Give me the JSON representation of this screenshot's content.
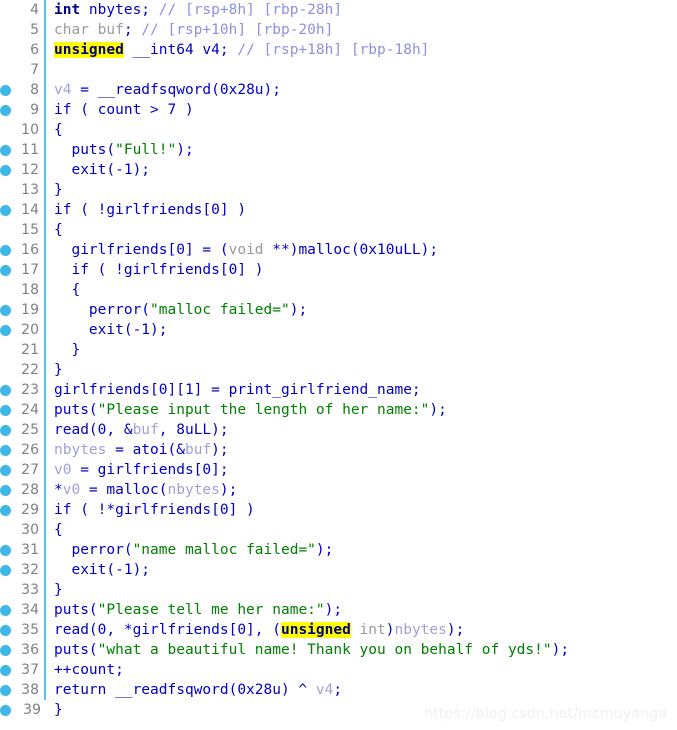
{
  "editor": {
    "kind": "decompiler-pseudocode",
    "language": "C",
    "accent_color": "#5bc0eb",
    "breakpoint_color": "#3eb8e8",
    "highlight_color": "#ffff00",
    "highlighted_token": "unsigned",
    "first_line_number": 4,
    "last_line_number": 39
  },
  "watermark": {
    "text": "https://blog.csdn.net/mcmuyanga"
  },
  "lines": [
    {
      "n": "4",
      "bp": false,
      "text": "int nbytes; // [rsp+8h] [rbp-28h]"
    },
    {
      "n": "5",
      "bp": false,
      "text": "char buf; // [rsp+10h] [rbp-20h]"
    },
    {
      "n": "6",
      "bp": false,
      "text": "unsigned __int64 v4; // [rsp+18h] [rbp-18h]"
    },
    {
      "n": "7",
      "bp": false,
      "text": ""
    },
    {
      "n": "8",
      "bp": true,
      "text": "v4 = __readfsqword(0x28u);"
    },
    {
      "n": "9",
      "bp": true,
      "text": "if ( count > 7 )"
    },
    {
      "n": "10",
      "bp": false,
      "text": "{"
    },
    {
      "n": "11",
      "bp": true,
      "text": "  puts(\"Full!\");"
    },
    {
      "n": "12",
      "bp": true,
      "text": "  exit(-1);"
    },
    {
      "n": "13",
      "bp": false,
      "text": "}"
    },
    {
      "n": "14",
      "bp": true,
      "text": "if ( !girlfriends[0] )"
    },
    {
      "n": "15",
      "bp": false,
      "text": "{"
    },
    {
      "n": "16",
      "bp": true,
      "text": "  girlfriends[0] = (void **)malloc(0x10uLL);"
    },
    {
      "n": "17",
      "bp": true,
      "text": "  if ( !girlfriends[0] )"
    },
    {
      "n": "18",
      "bp": false,
      "text": "  {"
    },
    {
      "n": "19",
      "bp": true,
      "text": "    perror(\"malloc failed=\");"
    },
    {
      "n": "20",
      "bp": true,
      "text": "    exit(-1);"
    },
    {
      "n": "21",
      "bp": false,
      "text": "  }"
    },
    {
      "n": "22",
      "bp": false,
      "text": "}"
    },
    {
      "n": "23",
      "bp": true,
      "text": "girlfriends[0][1] = print_girlfriend_name;"
    },
    {
      "n": "24",
      "bp": true,
      "text": "puts(\"Please input the length of her name:\");"
    },
    {
      "n": "25",
      "bp": true,
      "text": "read(0, &buf, 8uLL);"
    },
    {
      "n": "26",
      "bp": true,
      "text": "nbytes = atoi(&buf);"
    },
    {
      "n": "27",
      "bp": true,
      "text": "v0 = girlfriends[0];"
    },
    {
      "n": "28",
      "bp": true,
      "text": "*v0 = malloc(nbytes);"
    },
    {
      "n": "29",
      "bp": true,
      "text": "if ( !*girlfriends[0] )"
    },
    {
      "n": "30",
      "bp": false,
      "text": "{"
    },
    {
      "n": "31",
      "bp": true,
      "text": "  perror(\"name malloc failed=\");"
    },
    {
      "n": "32",
      "bp": true,
      "text": "  exit(-1);"
    },
    {
      "n": "33",
      "bp": false,
      "text": "}"
    },
    {
      "n": "34",
      "bp": true,
      "text": "puts(\"Please tell me her name:\");"
    },
    {
      "n": "35",
      "bp": true,
      "text": "read(0, *girlfriends[0], (unsigned int)nbytes);"
    },
    {
      "n": "36",
      "bp": true,
      "text": "puts(\"what a beautiful name! Thank you on behalf of yds!\");"
    },
    {
      "n": "37",
      "bp": true,
      "text": "++count;"
    },
    {
      "n": "38",
      "bp": true,
      "text": "return __readfsqword(0x28u) ^ v4;"
    },
    {
      "n": "39",
      "bp": true,
      "text": "}"
    }
  ],
  "tokens": {
    "line_4": [
      {
        "t": "int",
        "c": "kw"
      },
      {
        "t": " nbytes; ",
        "c": "plain"
      },
      {
        "t": "// [rsp+8h] [rbp-28h]",
        "c": "cmt"
      }
    ],
    "line_5": [
      {
        "t": "char",
        "c": "gray"
      },
      {
        "t": " buf",
        "c": "gray"
      },
      {
        "t": "; ",
        "c": "plain"
      },
      {
        "t": "// [rsp+10h] [rbp-20h]",
        "c": "cmt"
      }
    ],
    "line_6": [
      {
        "t": "unsigned",
        "c": "hl"
      },
      {
        "t": " __int64 v4; ",
        "c": "plain"
      },
      {
        "t": "// [rsp+18h] [rbp-18h]",
        "c": "cmt"
      }
    ],
    "line_8": [
      {
        "t": "v4",
        "c": "var"
      },
      {
        "t": " = __readfsqword(0x28u);",
        "c": "plain"
      }
    ],
    "line_16": [
      {
        "t": "  girlfriends[0] = (",
        "c": "plain"
      },
      {
        "t": "void",
        "c": "gray"
      },
      {
        "t": " **)malloc(0x10uLL);",
        "c": "plain"
      }
    ],
    "line_19": [
      {
        "t": "    perror(",
        "c": "plain"
      },
      {
        "t": "\"malloc failed=\"",
        "c": "str"
      },
      {
        "t": ");",
        "c": "plain"
      }
    ],
    "line_25": [
      {
        "t": "read(0, &",
        "c": "plain"
      },
      {
        "t": "buf",
        "c": "var"
      },
      {
        "t": ", 8uLL);",
        "c": "plain"
      }
    ],
    "line_26": [
      {
        "t": "nbytes",
        "c": "var"
      },
      {
        "t": " = atoi(&",
        "c": "plain"
      },
      {
        "t": "buf",
        "c": "var"
      },
      {
        "t": ");",
        "c": "plain"
      }
    ],
    "line_27": [
      {
        "t": "v0",
        "c": "var"
      },
      {
        "t": " = girlfriends[0];",
        "c": "plain"
      }
    ],
    "line_28": [
      {
        "t": "*",
        "c": "plain"
      },
      {
        "t": "v0",
        "c": "var"
      },
      {
        "t": " = malloc(",
        "c": "plain"
      },
      {
        "t": "nbytes",
        "c": "var"
      },
      {
        "t": ");",
        "c": "plain"
      }
    ],
    "line_35": [
      {
        "t": "read(0, *girlfriends[0], (",
        "c": "plain"
      },
      {
        "t": "unsigned",
        "c": "hl"
      },
      {
        "t": " int",
        "c": "gray"
      },
      {
        "t": ")",
        "c": "plain"
      },
      {
        "t": "nbytes",
        "c": "var"
      },
      {
        "t": ");",
        "c": "plain"
      }
    ],
    "line_38": [
      {
        "t": "return __readfsqword(0x28u) ^ ",
        "c": "plain"
      },
      {
        "t": "v4",
        "c": "var"
      },
      {
        "t": ";",
        "c": "plain"
      }
    ]
  },
  "rendered": [
    {
      "n": "4",
      "bp": false,
      "parts": [
        {
          "t": "int",
          "c": "kw"
        },
        {
          "t": " nbytes; ",
          "c": "plain"
        },
        {
          "t": "// [rsp+8h] [rbp-28h]",
          "c": "cmt"
        }
      ]
    },
    {
      "n": "5",
      "bp": false,
      "parts": [
        {
          "t": "char buf",
          "c": "gray"
        },
        {
          "t": "; ",
          "c": "plain"
        },
        {
          "t": "// [rsp+10h] [rbp-20h]",
          "c": "cmt"
        }
      ]
    },
    {
      "n": "6",
      "bp": false,
      "parts": [
        {
          "t": "unsigned",
          "c": "hl"
        },
        {
          "t": " __int64 v4; ",
          "c": "plain"
        },
        {
          "t": "// [rsp+18h] [rbp-18h]",
          "c": "cmt"
        }
      ]
    },
    {
      "n": "7",
      "bp": false,
      "parts": [
        {
          "t": "",
          "c": "plain"
        }
      ]
    },
    {
      "n": "8",
      "bp": true,
      "parts": [
        {
          "t": "v4",
          "c": "var"
        },
        {
          "t": " = __readfsqword(0x28u);",
          "c": "plain"
        }
      ]
    },
    {
      "n": "9",
      "bp": true,
      "parts": [
        {
          "t": "if ( count > 7 )",
          "c": "plain"
        }
      ]
    },
    {
      "n": "10",
      "bp": false,
      "parts": [
        {
          "t": "{",
          "c": "plain"
        }
      ]
    },
    {
      "n": "11",
      "bp": true,
      "parts": [
        {
          "t": "  puts(",
          "c": "plain"
        },
        {
          "t": "\"Full!\"",
          "c": "str"
        },
        {
          "t": ");",
          "c": "plain"
        }
      ]
    },
    {
      "n": "12",
      "bp": true,
      "parts": [
        {
          "t": "  exit(-1);",
          "c": "plain"
        }
      ]
    },
    {
      "n": "13",
      "bp": false,
      "parts": [
        {
          "t": "}",
          "c": "plain"
        }
      ]
    },
    {
      "n": "14",
      "bp": true,
      "parts": [
        {
          "t": "if ( !girlfriends[0] )",
          "c": "plain"
        }
      ]
    },
    {
      "n": "15",
      "bp": false,
      "parts": [
        {
          "t": "{",
          "c": "plain"
        }
      ]
    },
    {
      "n": "16",
      "bp": true,
      "parts": [
        {
          "t": "  girlfriends[0] = (",
          "c": "plain"
        },
        {
          "t": "void",
          "c": "gray"
        },
        {
          "t": " **)malloc(0x10uLL);",
          "c": "plain"
        }
      ]
    },
    {
      "n": "17",
      "bp": true,
      "parts": [
        {
          "t": "  if ( !girlfriends[0] )",
          "c": "plain"
        }
      ]
    },
    {
      "n": "18",
      "bp": false,
      "parts": [
        {
          "t": "  {",
          "c": "plain"
        }
      ]
    },
    {
      "n": "19",
      "bp": true,
      "parts": [
        {
          "t": "    perror(",
          "c": "plain"
        },
        {
          "t": "\"malloc failed=\"",
          "c": "str"
        },
        {
          "t": ");",
          "c": "plain"
        }
      ]
    },
    {
      "n": "20",
      "bp": true,
      "parts": [
        {
          "t": "    exit(-1);",
          "c": "plain"
        }
      ]
    },
    {
      "n": "21",
      "bp": false,
      "parts": [
        {
          "t": "  }",
          "c": "plain"
        }
      ]
    },
    {
      "n": "22",
      "bp": false,
      "parts": [
        {
          "t": "}",
          "c": "plain"
        }
      ]
    },
    {
      "n": "23",
      "bp": true,
      "parts": [
        {
          "t": "girlfriends[0][1] = print_girlfriend_name;",
          "c": "plain"
        }
      ]
    },
    {
      "n": "24",
      "bp": true,
      "parts": [
        {
          "t": "puts(",
          "c": "plain"
        },
        {
          "t": "\"Please input the length of her name:\"",
          "c": "str"
        },
        {
          "t": ");",
          "c": "plain"
        }
      ]
    },
    {
      "n": "25",
      "bp": true,
      "parts": [
        {
          "t": "read(0, &",
          "c": "plain"
        },
        {
          "t": "buf",
          "c": "var"
        },
        {
          "t": ", 8uLL);",
          "c": "plain"
        }
      ]
    },
    {
      "n": "26",
      "bp": true,
      "parts": [
        {
          "t": "nbytes",
          "c": "var"
        },
        {
          "t": " = atoi(&",
          "c": "plain"
        },
        {
          "t": "buf",
          "c": "var"
        },
        {
          "t": ");",
          "c": "plain"
        }
      ]
    },
    {
      "n": "27",
      "bp": true,
      "parts": [
        {
          "t": "v0",
          "c": "var"
        },
        {
          "t": " = girlfriends[0];",
          "c": "plain"
        }
      ]
    },
    {
      "n": "28",
      "bp": true,
      "parts": [
        {
          "t": "*",
          "c": "plain"
        },
        {
          "t": "v0",
          "c": "var"
        },
        {
          "t": " = malloc(",
          "c": "plain"
        },
        {
          "t": "nbytes",
          "c": "var"
        },
        {
          "t": ");",
          "c": "plain"
        }
      ]
    },
    {
      "n": "29",
      "bp": true,
      "parts": [
        {
          "t": "if ( !*girlfriends[0] )",
          "c": "plain"
        }
      ]
    },
    {
      "n": "30",
      "bp": false,
      "parts": [
        {
          "t": "{",
          "c": "plain"
        }
      ]
    },
    {
      "n": "31",
      "bp": true,
      "parts": [
        {
          "t": "  perror(",
          "c": "plain"
        },
        {
          "t": "\"name malloc failed=\"",
          "c": "str"
        },
        {
          "t": ");",
          "c": "plain"
        }
      ]
    },
    {
      "n": "32",
      "bp": true,
      "parts": [
        {
          "t": "  exit(-1);",
          "c": "plain"
        }
      ]
    },
    {
      "n": "33",
      "bp": false,
      "parts": [
        {
          "t": "}",
          "c": "plain"
        }
      ]
    },
    {
      "n": "34",
      "bp": true,
      "parts": [
        {
          "t": "puts(",
          "c": "plain"
        },
        {
          "t": "\"Please tell me her name:\"",
          "c": "str"
        },
        {
          "t": ");",
          "c": "plain"
        }
      ]
    },
    {
      "n": "35",
      "bp": true,
      "parts": [
        {
          "t": "read(0, *girlfriends[0], (",
          "c": "plain"
        },
        {
          "t": "unsigned",
          "c": "hl"
        },
        {
          "t": " int",
          "c": "gray"
        },
        {
          "t": ")",
          "c": "plain"
        },
        {
          "t": "nbytes",
          "c": "var"
        },
        {
          "t": ");",
          "c": "plain"
        }
      ]
    },
    {
      "n": "36",
      "bp": true,
      "parts": [
        {
          "t": "puts(",
          "c": "plain"
        },
        {
          "t": "\"what a beautiful name! Thank you on behalf of yds!\"",
          "c": "str"
        },
        {
          "t": ");",
          "c": "plain"
        }
      ]
    },
    {
      "n": "37",
      "bp": true,
      "parts": [
        {
          "t": "++count;",
          "c": "plain"
        }
      ]
    },
    {
      "n": "38",
      "bp": true,
      "parts": [
        {
          "t": "return __readfsqword(0x28u) ^ ",
          "c": "plain"
        },
        {
          "t": "v4",
          "c": "var"
        },
        {
          "t": ";",
          "c": "plain"
        }
      ]
    },
    {
      "n": "39",
      "bp": true,
      "parts": [
        {
          "t": "}",
          "c": "plain"
        }
      ],
      "no_gutter_border": true
    }
  ]
}
